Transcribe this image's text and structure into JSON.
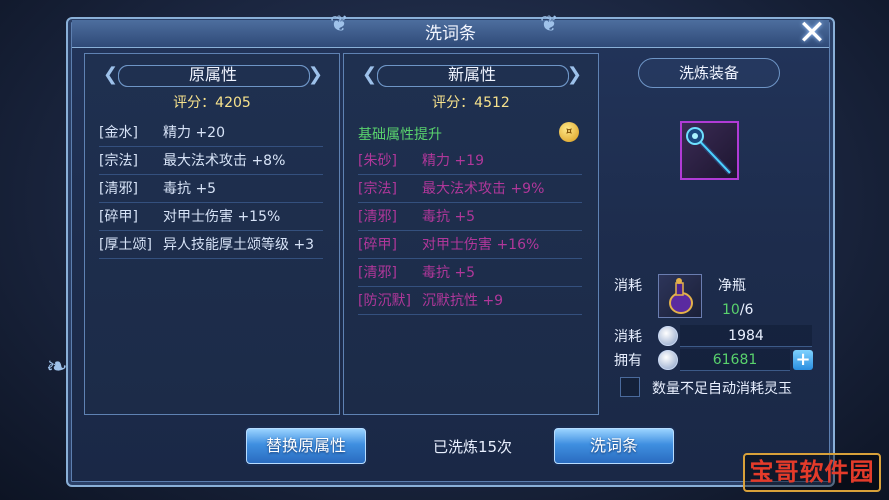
{
  "window": {
    "title": "洗词条",
    "close_label": "✕"
  },
  "left": {
    "title": "原属性",
    "score": "评分：4205",
    "rows": [
      {
        "tag": "[金水]",
        "val": "精力 +20"
      },
      {
        "tag": "[宗法]",
        "val": "最大法术攻击 +8%"
      },
      {
        "tag": "[清邪]",
        "val": "毒抗 +5"
      },
      {
        "tag": "[碎甲]",
        "val": "对甲士伤害 +15%"
      },
      {
        "tag": "[厚土颂]",
        "val": "异人技能厚土颂等级 +3"
      }
    ]
  },
  "right": {
    "title": "新属性",
    "score": "评分：4512",
    "boost": "基础属性提升",
    "coin": "¤",
    "rows": [
      {
        "tag": "[朱砂]",
        "val": "精力 +19"
      },
      {
        "tag": "[宗法]",
        "val": "最大法术攻击 +9%"
      },
      {
        "tag": "[清邪]",
        "val": "毒抗 +5"
      },
      {
        "tag": "[碎甲]",
        "val": "对甲士伤害 +16%"
      },
      {
        "tag": "[清邪]",
        "val": "毒抗 +5"
      },
      {
        "tag": "[防沉默]",
        "val": "沉默抗性 +9"
      }
    ]
  },
  "equip": {
    "title": "洗炼装备"
  },
  "cost": {
    "label1": "消耗",
    "item_name": "净瓶",
    "have": "10",
    "need": "/6",
    "label2": "消耗",
    "silver_cost": "1984",
    "label3": "拥有",
    "silver_have": "61681",
    "plus": "+",
    "auto_label": "数量不足自动消耗灵玉"
  },
  "buttons": {
    "replace": "替换原属性",
    "wash": "洗词条"
  },
  "status": {
    "washed": "已洗炼15次"
  },
  "watermark": "宝哥软件园",
  "colors": {
    "accent": "#3f8fe0",
    "boost": "#59d26d",
    "score": "#f7e28c",
    "new_attr": "#b0379a",
    "purple_border": "#b13bd6"
  }
}
